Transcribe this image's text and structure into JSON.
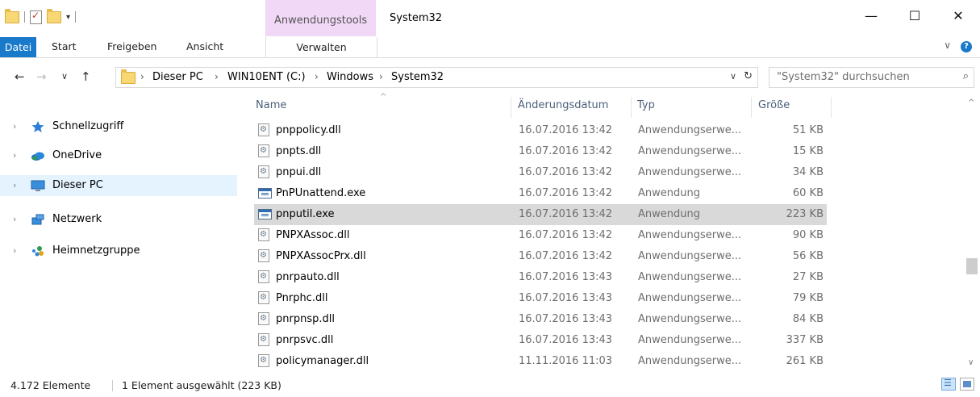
{
  "window": {
    "title": "System32",
    "context_tab_group": "Anwendungstools",
    "minimize_glyph": "—",
    "maximize_glyph": "☐",
    "close_glyph": "✕"
  },
  "ribbon": {
    "tabs": [
      "Datei",
      "Start",
      "Freigeben",
      "Ansicht",
      "Verwalten"
    ],
    "help_glyph": "?",
    "collapse_glyph": "∨"
  },
  "address": {
    "back_glyph": "←",
    "forward_glyph": "→",
    "recent_glyph": "∨",
    "up_glyph": "↑",
    "breadcrumbs": [
      "Dieser PC",
      "WIN10ENT (C:)",
      "Windows",
      "System32"
    ],
    "separator": "›",
    "dropdown_glyph": "∨",
    "refresh_glyph": "↻"
  },
  "search": {
    "placeholder": "\"System32\" durchsuchen",
    "icon_glyph": "⌕"
  },
  "navigation": {
    "chevron": "›",
    "items": [
      {
        "label": "Schnellzugriff",
        "icon": "star-icon",
        "selected": false
      },
      {
        "label": "OneDrive",
        "icon": "cloud-icon",
        "selected": false
      },
      {
        "label": "Dieser PC",
        "icon": "computer-icon",
        "selected": true
      },
      {
        "label": "Netzwerk",
        "icon": "network-icon",
        "selected": false
      },
      {
        "label": "Heimnetzgruppe",
        "icon": "homegroup-icon",
        "selected": false
      }
    ]
  },
  "columns": {
    "name": "Name",
    "date": "Änderungsdatum",
    "type": "Typ",
    "size": "Größe",
    "sort_glyph": "^"
  },
  "files": [
    {
      "name": "pnppolicy.dll",
      "date": "16.07.2016 13:42",
      "type": "Anwendungserwe...",
      "size": "51 KB",
      "kind": "dll",
      "selected": false
    },
    {
      "name": "pnpts.dll",
      "date": "16.07.2016 13:42",
      "type": "Anwendungserwe...",
      "size": "15 KB",
      "kind": "dll",
      "selected": false
    },
    {
      "name": "pnpui.dll",
      "date": "16.07.2016 13:42",
      "type": "Anwendungserwe...",
      "size": "34 KB",
      "kind": "dll",
      "selected": false
    },
    {
      "name": "PnPUnattend.exe",
      "date": "16.07.2016 13:42",
      "type": "Anwendung",
      "size": "60 KB",
      "kind": "exe",
      "selected": false
    },
    {
      "name": "pnputil.exe",
      "date": "16.07.2016 13:42",
      "type": "Anwendung",
      "size": "223 KB",
      "kind": "exe",
      "selected": true
    },
    {
      "name": "PNPXAssoc.dll",
      "date": "16.07.2016 13:42",
      "type": "Anwendungserwe...",
      "size": "90 KB",
      "kind": "dll",
      "selected": false
    },
    {
      "name": "PNPXAssocPrx.dll",
      "date": "16.07.2016 13:42",
      "type": "Anwendungserwe...",
      "size": "56 KB",
      "kind": "dll",
      "selected": false
    },
    {
      "name": "pnrpauto.dll",
      "date": "16.07.2016 13:43",
      "type": "Anwendungserwe...",
      "size": "27 KB",
      "kind": "dll",
      "selected": false
    },
    {
      "name": "Pnrphc.dll",
      "date": "16.07.2016 13:43",
      "type": "Anwendungserwe...",
      "size": "79 KB",
      "kind": "dll",
      "selected": false
    },
    {
      "name": "pnrpnsp.dll",
      "date": "16.07.2016 13:43",
      "type": "Anwendungserwe...",
      "size": "84 KB",
      "kind": "dll",
      "selected": false
    },
    {
      "name": "pnrpsvc.dll",
      "date": "16.07.2016 13:43",
      "type": "Anwendungserwe...",
      "size": "337 KB",
      "kind": "dll",
      "selected": false
    },
    {
      "name": "policymanager.dll",
      "date": "11.11.2016 11:03",
      "type": "Anwendungserwe...",
      "size": "261 KB",
      "kind": "dll",
      "selected": false
    }
  ],
  "scrollbar": {
    "up_glyph": "^",
    "down_glyph": "∨"
  },
  "status": {
    "count": "4.172 Elemente",
    "selection": "1 Element ausgewählt (223 KB)"
  },
  "colors": {
    "accent": "#1979ca",
    "context_tab": "#f0d8f6",
    "selection_row": "#d9d9d9",
    "nav_selected": "#e5f3ff"
  }
}
